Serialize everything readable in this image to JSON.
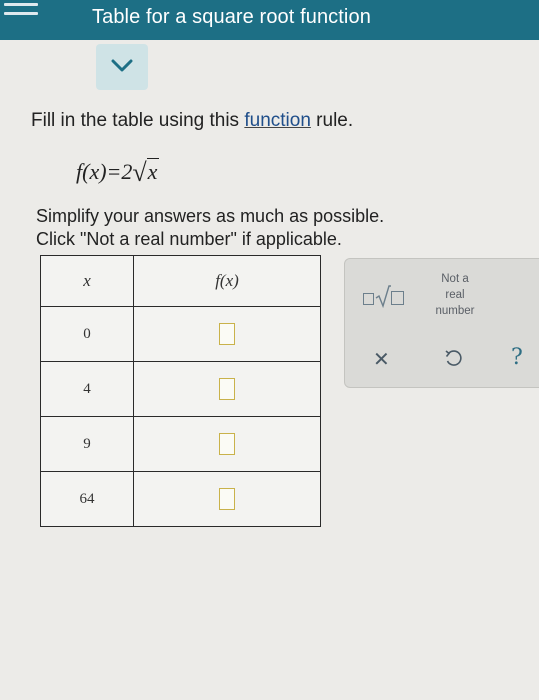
{
  "header": {
    "title": "Table for a square root function"
  },
  "question": {
    "instruction_prefix": "Fill in the table using this ",
    "instruction_link": "function",
    "instruction_suffix": " rule.",
    "formula_lhs": "f(x)=2",
    "formula_radicand": "x",
    "note_line1": "Simplify your answers as much as possible.",
    "note_line2": "Click \"Not a real number\" if applicable."
  },
  "table": {
    "header_x": "x",
    "header_fx": "f(x)",
    "rows": [
      {
        "x": "0",
        "fx": ""
      },
      {
        "x": "4",
        "fx": ""
      },
      {
        "x": "9",
        "fx": ""
      },
      {
        "x": "64",
        "fx": ""
      }
    ]
  },
  "keypad": {
    "not_real_line1": "Not a",
    "not_real_line2": "real",
    "not_real_line3": "number",
    "clear_symbol": "✕",
    "help_symbol": "?"
  },
  "icons": {
    "menu": "menu-icon",
    "collapse": "chevron-down-icon",
    "sqrt": "square-root-template-icon",
    "undo": "undo-icon"
  },
  "colors": {
    "header_bar": "#1d6f85",
    "link": "#1f4e8a",
    "answer_box_border": "#c9b24a",
    "help": "#2e6e84"
  }
}
